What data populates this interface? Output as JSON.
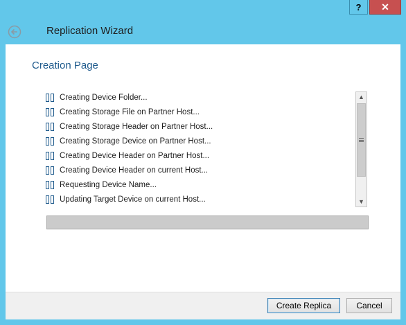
{
  "titlebar": {
    "help_label": "?",
    "close_label": "✕"
  },
  "wizard": {
    "title": "Replication Wizard"
  },
  "page": {
    "title": "Creation Page"
  },
  "steps": [
    "Creating Device Folder...",
    "Creating Storage File on Partner Host...",
    "Creating Storage Header on Partner Host...",
    "Creating Storage Device on Partner Host...",
    "Creating Device Header on Partner Host...",
    "Creating Device Header on current Host...",
    "Requesting Device Name...",
    "Updating Target Device on current Host..."
  ],
  "progress": {
    "value": 0
  },
  "buttons": {
    "create": "Create Replica",
    "cancel": "Cancel"
  },
  "colors": {
    "accent": "#62c7ea",
    "title_text": "#1e5a8c",
    "close": "#c75050"
  },
  "icons": {
    "back": "back-arrow-icon",
    "step": "step-status-icon",
    "scroll_up": "scroll-up-icon",
    "scroll_down": "scroll-down-icon"
  }
}
